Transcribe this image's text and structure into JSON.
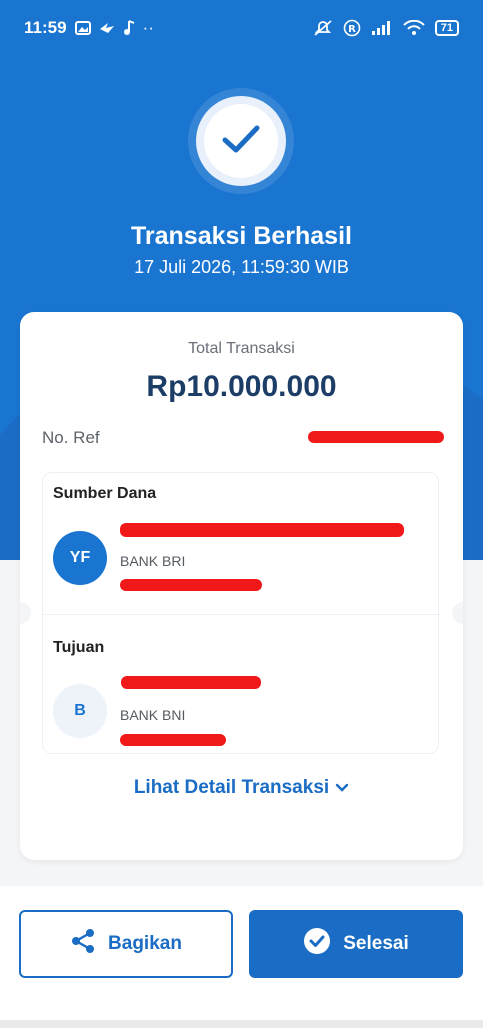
{
  "status_bar": {
    "time": "11:59",
    "battery": "71",
    "extra": "··"
  },
  "header": {
    "title": "Transaksi Berhasil",
    "datetime": "17 Juli 2026, 11:59:30 WIB"
  },
  "summary": {
    "total_label": "Total Transaksi",
    "total_amount": "Rp10.000.000",
    "ref_label": "No. Ref"
  },
  "source": {
    "title": "Sumber Dana",
    "initials": "YF",
    "bank": "BANK BRI"
  },
  "destination": {
    "title": "Tujuan",
    "initials": "B",
    "bank": "BANK BNI"
  },
  "detail_link": "Lihat Detail Transaksi",
  "actions": {
    "share_label": "Bagikan",
    "done_label": "Selesai"
  },
  "colors": {
    "primary": "#1a75d1",
    "redaction": "#f01818"
  }
}
